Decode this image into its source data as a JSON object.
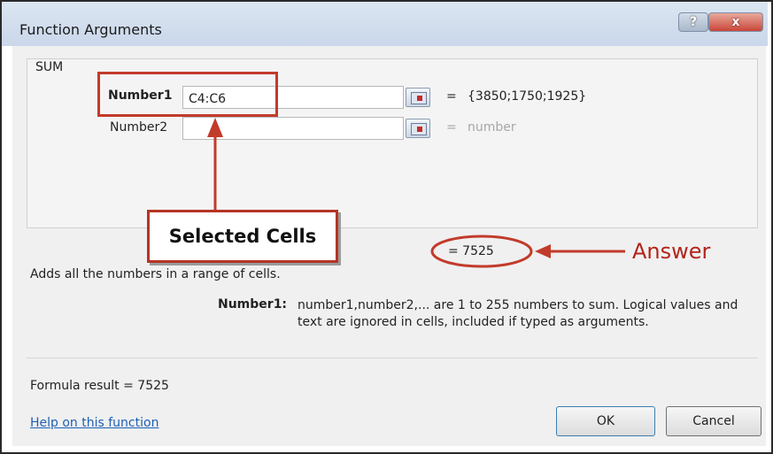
{
  "window": {
    "title": "Function Arguments",
    "help_button": "?",
    "close_button": "x"
  },
  "function": {
    "name": "SUM",
    "args": [
      {
        "label": "Number1",
        "value": "C4:C6",
        "result": "{3850;1750;1925}"
      },
      {
        "label": "Number2",
        "value": "",
        "result": "number"
      }
    ],
    "equals": "=",
    "result": "= 7525",
    "description": "Adds all the numbers in a range of cells.",
    "arg_help_name": "Number1:",
    "arg_help_text": "number1,number2,... are 1 to 255 numbers to sum. Logical values and text are ignored in cells, included if typed as arguments."
  },
  "annotations": {
    "selected_cells": "Selected Cells",
    "answer": "Answer",
    "color": "#c23b2b"
  },
  "footer": {
    "formula_result": "Formula result =  7525",
    "help_link": "Help on this function",
    "ok": "OK",
    "cancel": "Cancel"
  },
  "icons": [
    "range-selector-icon",
    "arrow-up-icon",
    "arrow-left-icon"
  ]
}
